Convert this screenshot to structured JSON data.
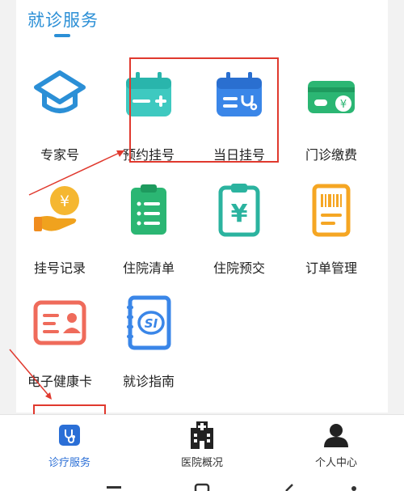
{
  "section": {
    "title": "就诊服务"
  },
  "services": [
    {
      "label": "专家号",
      "icon": "graduation-cap-icon"
    },
    {
      "label": "预约挂号",
      "icon": "calendar-plus-icon"
    },
    {
      "label": "当日挂号",
      "icon": "calendar-stethoscope-icon"
    },
    {
      "label": "门诊缴费",
      "icon": "card-yen-icon"
    },
    {
      "label": "挂号记录",
      "icon": "hand-coin-icon"
    },
    {
      "label": "住院清单",
      "icon": "clipboard-list-icon"
    },
    {
      "label": "住院预交",
      "icon": "clipboard-yen-icon"
    },
    {
      "label": "订单管理",
      "icon": "receipt-barcode-icon"
    },
    {
      "label": "电子健康卡",
      "icon": "id-card-icon"
    },
    {
      "label": "就诊指南",
      "icon": "si-guide-book-icon"
    }
  ],
  "tabbar": {
    "tabs": [
      {
        "label": "诊疗服务",
        "icon": "stethoscope-icon",
        "active": true
      },
      {
        "label": "医院概况",
        "icon": "hospital-icon",
        "active": false
      },
      {
        "label": "个人中心",
        "icon": "user-icon",
        "active": false
      }
    ]
  },
  "colors": {
    "accent": "#2b8fd6",
    "annotation": "#e0392e",
    "green": "#2bb673",
    "orange": "#f5a623",
    "red": "#ef6b5b"
  }
}
